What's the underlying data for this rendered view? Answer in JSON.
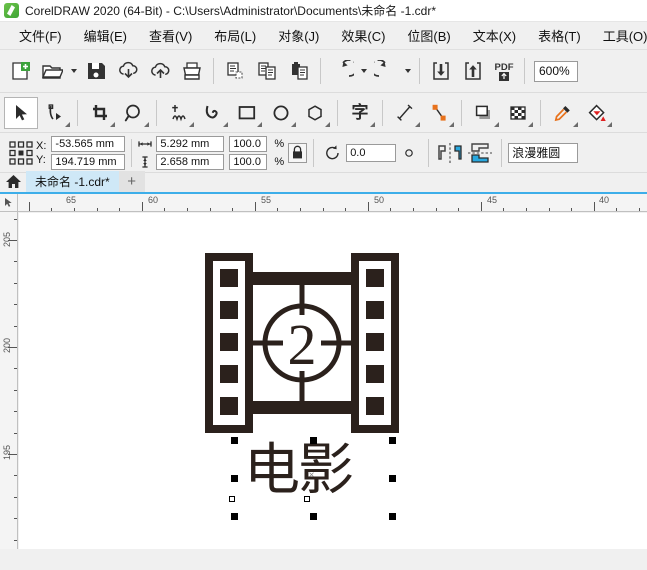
{
  "window": {
    "title": "CorelDRAW 2020 (64-Bit) - C:\\Users\\Administrator\\Documents\\未命名 -1.cdr*",
    "logo_icon": "coreldraw-logo"
  },
  "menubar": {
    "items": [
      {
        "label": "文件(F)"
      },
      {
        "label": "编辑(E)"
      },
      {
        "label": "查看(V)"
      },
      {
        "label": "布局(L)"
      },
      {
        "label": "对象(J)"
      },
      {
        "label": "效果(C)"
      },
      {
        "label": "位图(B)"
      },
      {
        "label": "文本(X)"
      },
      {
        "label": "表格(T)"
      },
      {
        "label": "工具(O)"
      }
    ]
  },
  "toolbar": {
    "buttons": [
      {
        "name": "new-document",
        "icon": "new-document-icon"
      },
      {
        "name": "open-document",
        "icon": "open-folder-icon"
      },
      {
        "name": "save-document",
        "icon": "save-floppy-icon"
      },
      {
        "name": "download-from-cloud",
        "icon": "cloud-download-icon"
      },
      {
        "name": "upload-to-cloud",
        "icon": "cloud-upload-icon"
      },
      {
        "name": "print",
        "icon": "printer-icon"
      },
      {
        "name": "cut",
        "icon": "cut-icon"
      },
      {
        "name": "copy",
        "icon": "copy-icon"
      },
      {
        "name": "paste",
        "icon": "paste-icon"
      },
      {
        "name": "undo",
        "icon": "undo-arrow-icon"
      },
      {
        "name": "redo",
        "icon": "redo-arrow-icon"
      },
      {
        "name": "import",
        "icon": "import-arrow-down-icon"
      },
      {
        "name": "export",
        "icon": "export-arrow-up-icon"
      },
      {
        "name": "export-pdf",
        "icon": "pdf-icon"
      }
    ],
    "pdf_label": "PDF",
    "zoom_level": "600%"
  },
  "toolbox": {
    "tools": [
      {
        "name": "pick-tool",
        "icon": "cursor-arrow-icon",
        "active": true
      },
      {
        "name": "shape-tool",
        "icon": "shape-node-icon",
        "active": false
      },
      {
        "name": "crop-tool",
        "icon": "crop-icon",
        "active": false
      },
      {
        "name": "zoom-tool",
        "icon": "magnifier-icon",
        "active": false
      },
      {
        "name": "freehand-tool",
        "icon": "freehand-pen-icon",
        "active": false
      },
      {
        "name": "artistic-media-tool",
        "icon": "artistic-media-icon",
        "active": false
      },
      {
        "name": "rectangle-tool",
        "icon": "rectangle-icon",
        "active": false
      },
      {
        "name": "ellipse-tool",
        "icon": "ellipse-icon",
        "active": false
      },
      {
        "name": "polygon-tool",
        "icon": "polygon-icon",
        "active": false
      },
      {
        "name": "text-tool",
        "icon": "text-character-icon",
        "active": false,
        "glyph": "字"
      },
      {
        "name": "dimension-tool",
        "icon": "dimension-line-icon",
        "active": false
      },
      {
        "name": "connector-tool",
        "icon": "connector-icon",
        "active": false
      },
      {
        "name": "drop-shadow-tool",
        "icon": "drop-shadow-icon",
        "active": false
      },
      {
        "name": "transparency-tool",
        "icon": "transparency-checker-icon",
        "active": false
      },
      {
        "name": "color-eyedropper-tool",
        "icon": "eyedropper-icon",
        "active": false
      },
      {
        "name": "interactive-fill-tool",
        "icon": "fill-bucket-icon",
        "active": false
      }
    ]
  },
  "propertybar": {
    "anchor_icon": "object-origin-grid-icon",
    "x_label": "X:",
    "y_label": "Y:",
    "x_value": "-53.565 mm",
    "y_value": "194.719 mm",
    "width_icon": "width-arrows-icon",
    "height_icon": "height-arrows-icon",
    "width_value": "5.292 mm",
    "height_value": "2.658 mm",
    "scale_x_value": "100.0",
    "scale_y_value": "100.0",
    "percent_label": "%",
    "lock_icon": "lock-ratio-icon",
    "rotate_icon": "rotation-icon",
    "rotation_value": "0.0",
    "degree_icon": "degree-circle-icon",
    "mirror_h_icon": "mirror-horizontal-icon",
    "mirror_v_icon": "mirror-vertical-icon",
    "align_icon": "align-distribute-icon",
    "font_name": "浪漫雅圆"
  },
  "tabbar": {
    "home_icon": "home-icon",
    "document_tab": "未命名 -1.cdr*",
    "add_tab_label": "+"
  },
  "rulers": {
    "unit": "mm",
    "horizontal_labels": [
      "65",
      "60",
      "55",
      "50",
      "45",
      "40"
    ],
    "vertical_labels": [
      "205",
      "200",
      "195"
    ],
    "cursor_icon": "ruler-origin-icon"
  },
  "canvas": {
    "artwork_color": "#2b211c",
    "film_icon_name": "film-strip-countdown-graphic",
    "countdown_number": "2",
    "text_object": "电影",
    "selection_handles": 8
  }
}
